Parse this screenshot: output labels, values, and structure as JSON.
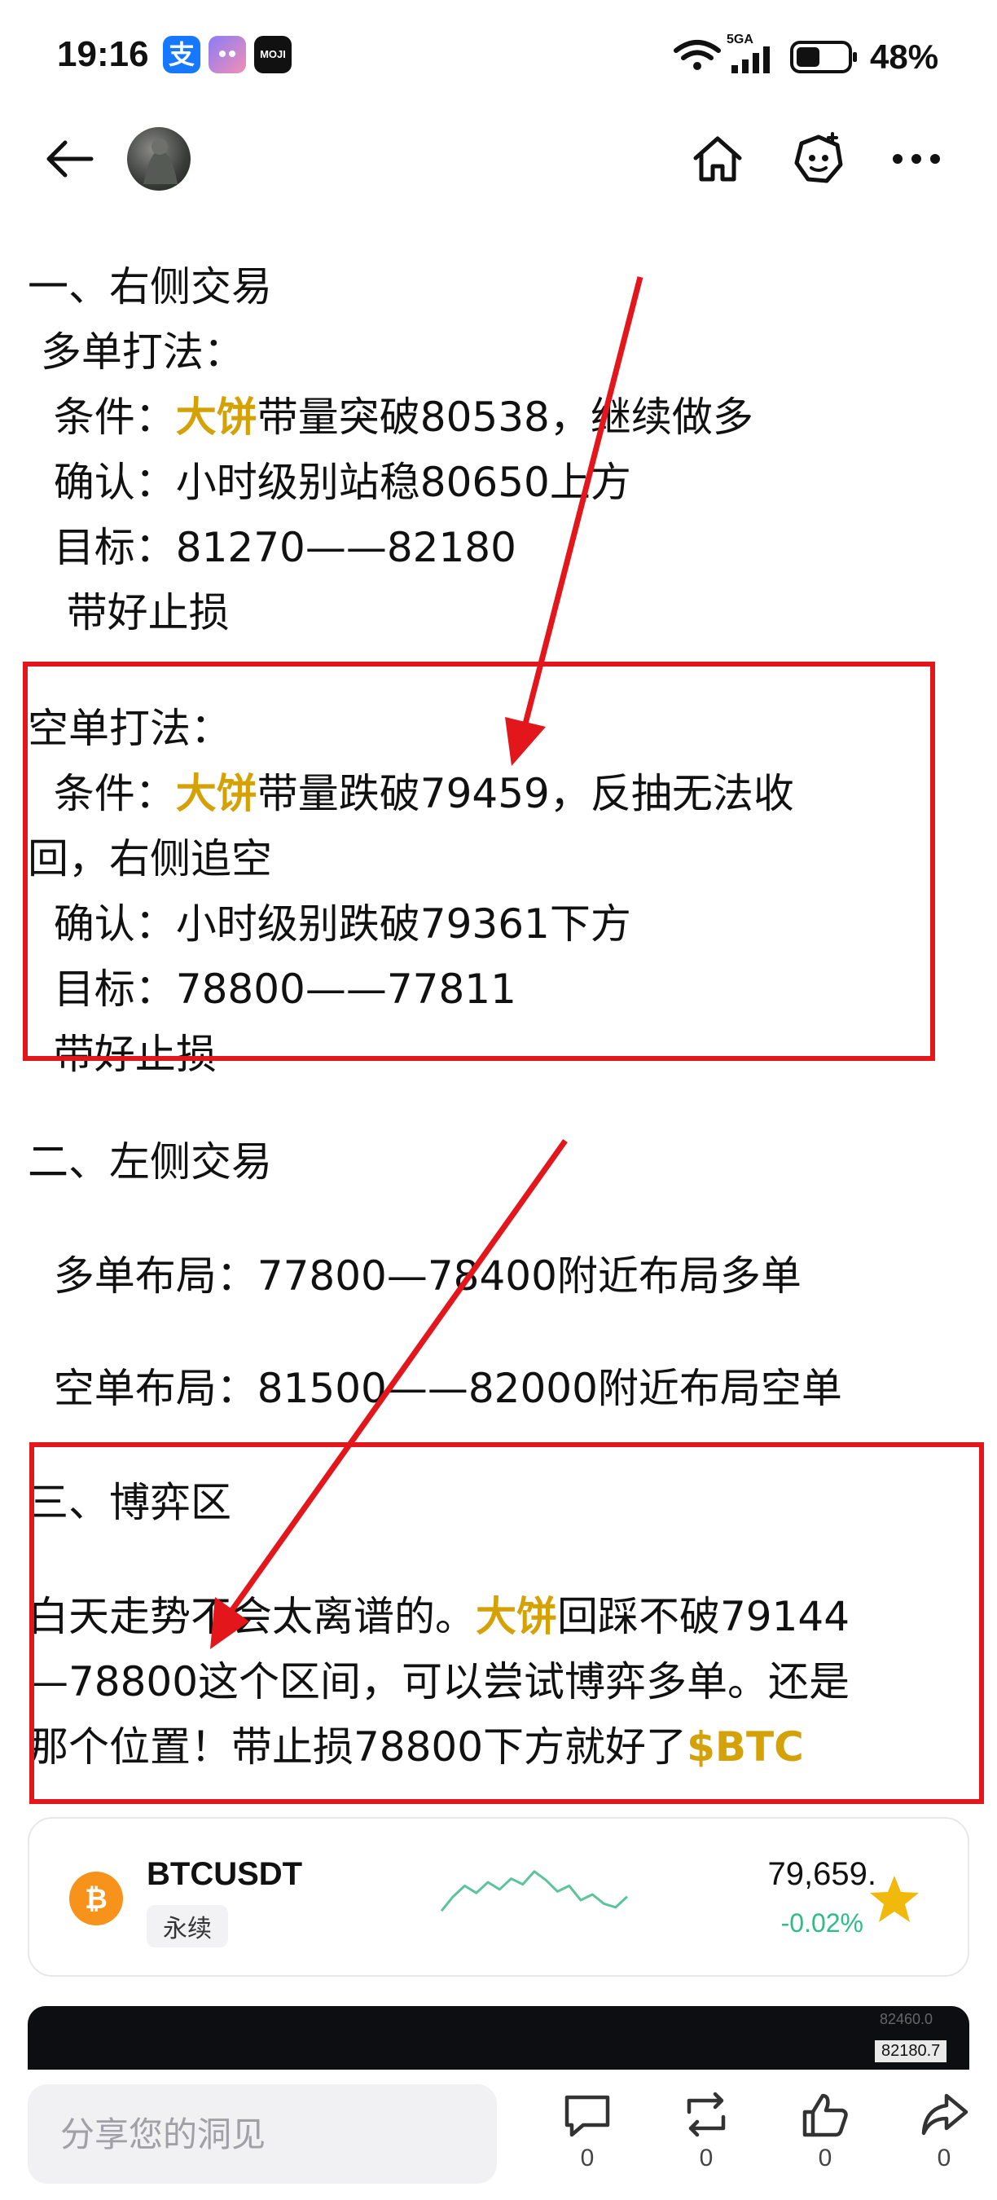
{
  "status_bar": {
    "time": "19:16",
    "network": "5GA",
    "battery": "48%",
    "apps": [
      {
        "icon": "alipay-icon",
        "glyph": "支"
      },
      {
        "icon": "soul-app-icon",
        "glyph": ""
      },
      {
        "icon": "moji-weather-icon",
        "glyph": "MOJI"
      }
    ]
  },
  "article": {
    "section1_title": "一、右侧交易",
    "long_title": " 多单打法：",
    "long_cond_prefix": "  条件：",
    "long_cond_hl": "大饼",
    "long_cond_rest": "带量突破80538，继续做多",
    "long_confirm": "  确认：小时级别站稳80650上方",
    "long_target": "  目标：81270——82180",
    "long_stop": "   带好止损",
    "short_title": "空单打法：",
    "short_cond_prefix": "  条件：",
    "short_cond_hl": "大饼",
    "short_cond_rest": "带量跌破79459，反抽无法收",
    "short_cond_line2": "回，右侧追空",
    "short_confirm": "  确认：小时级别跌破79361下方",
    "short_target": "  目标：78800——77811",
    "short_stop": "  带好止损",
    "section2_title": "二、左侧交易",
    "left_long": "  多单布局：77800—78400附近布局多单",
    "left_short": "  空单布局：81500——82000附近布局空单",
    "section3_title": "三、博弈区",
    "game_l1_prefix": "白天走势不会太离谱的。",
    "game_l1_hl": "大饼",
    "game_l1_rest": "回踩不破79144",
    "game_l2": "—78800这个区间，可以尝试博弈多单。还是",
    "game_l3_prefix": "那个位置！带止损78800下方就好了",
    "game_l3_tag": "$BTC"
  },
  "coin_card": {
    "symbol": "BTCUSDT",
    "type": "永续",
    "price": "79,659.",
    "change": "-0.02%",
    "coin_icon": "bitcoin-icon",
    "change_color": "#2EBD85",
    "sparkline": [
      0.35,
      0.55,
      0.7,
      0.6,
      0.75,
      0.65,
      0.8,
      0.72,
      0.9,
      0.78,
      0.62,
      0.7,
      0.5,
      0.58,
      0.45,
      0.4,
      0.55
    ]
  },
  "chart_preview": {
    "price_label_top": "82460.0",
    "price_label": "82180.7"
  },
  "bottom_bar": {
    "input_placeholder": "分享您的洞见",
    "comment_count": "0",
    "repost_count": "0",
    "like_count": "0",
    "share_count": "0"
  },
  "colors": {
    "highlight": "#D4A106",
    "annotation_red": "#E3161B",
    "bitcoin_orange": "#F7931A",
    "star": "#F0B90B"
  }
}
